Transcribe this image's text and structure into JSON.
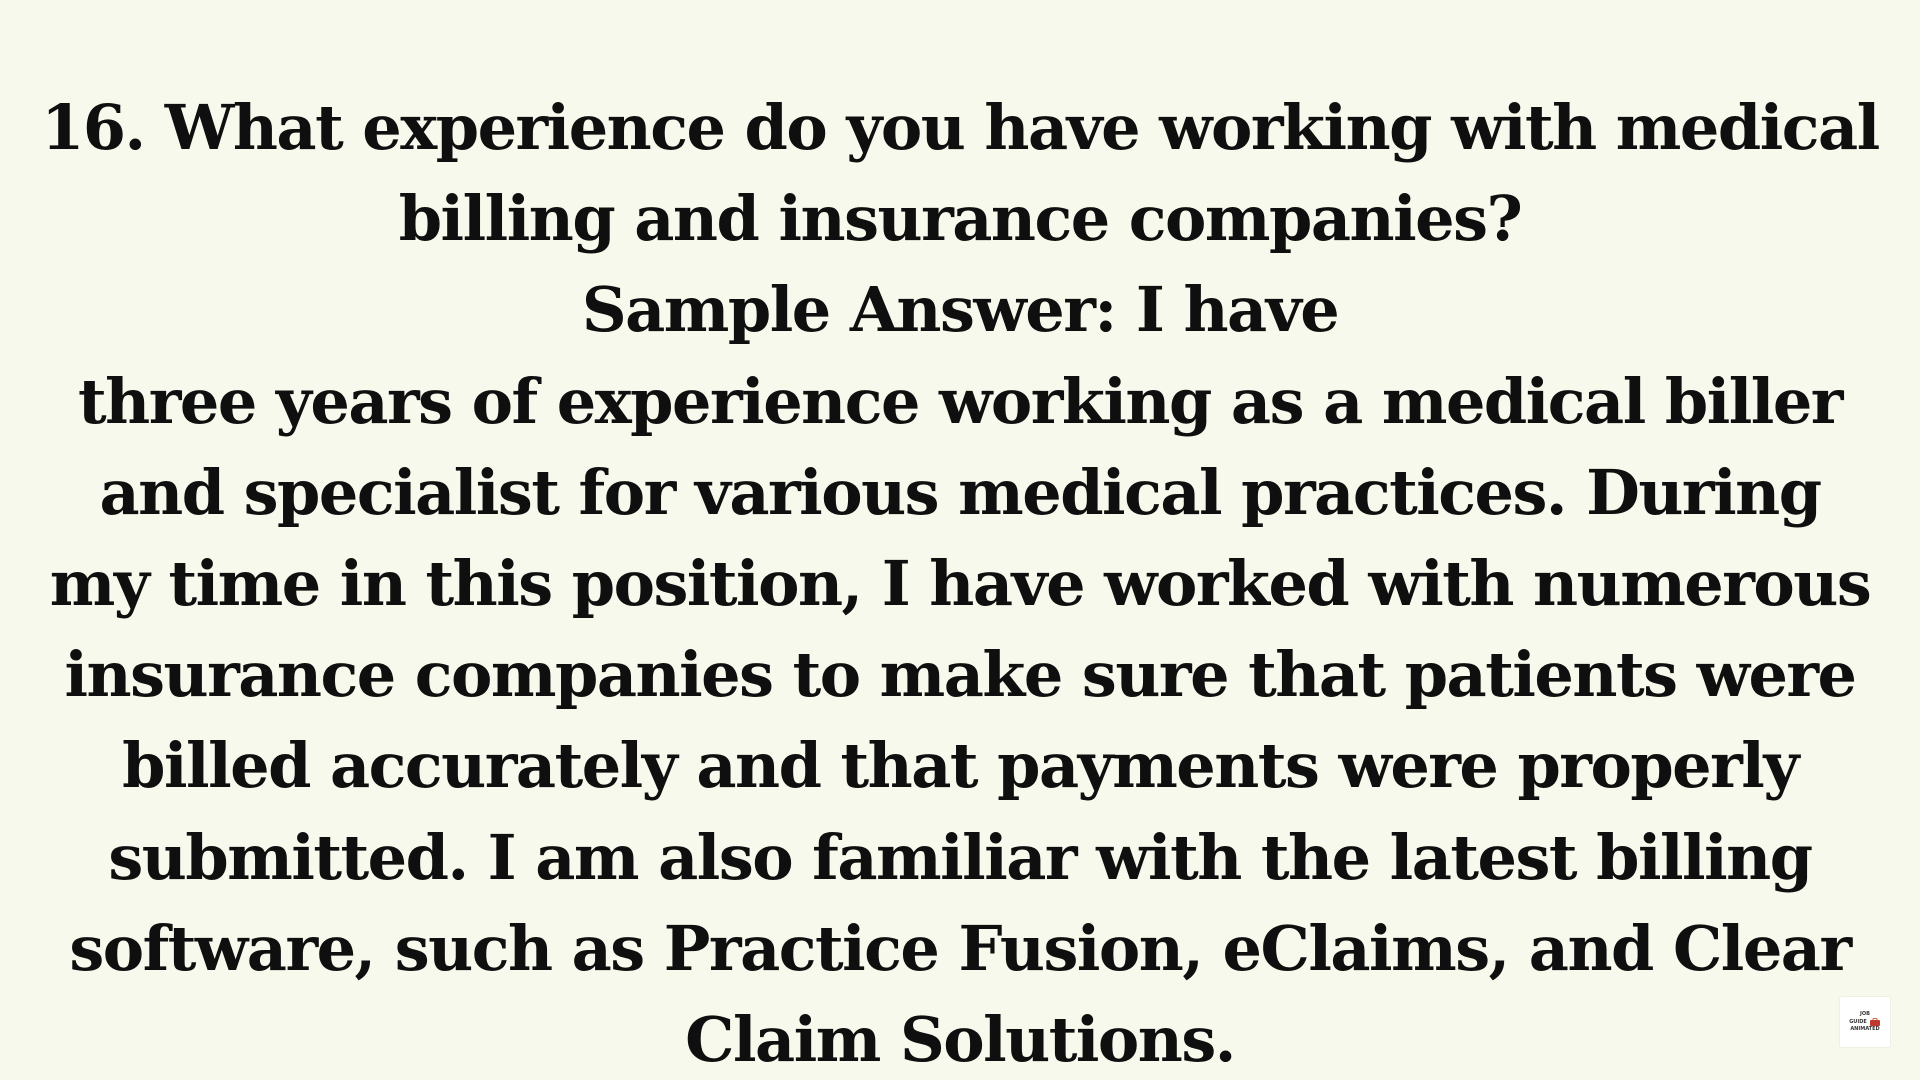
{
  "question": {
    "lines": [
      "16. What experience do you have working with medical",
      "billing and insurance companies?"
    ]
  },
  "answer": {
    "lines": [
      "Sample Answer: I have",
      "three years of experience working as a medical biller",
      "and specialist for various medical practices. During",
      "my time in this position, I have worked with numerous",
      "insurance companies to make sure that patients were",
      "billed accurately and that payments were properly",
      "submitted. I am also familiar with the latest billing",
      "software, such as Practice Fusion, eClaims, and Clear",
      "Claim Solutions."
    ]
  },
  "watermark": {
    "line1": "JOB",
    "line2": "GUIDE",
    "line3": "ANIMATED",
    "accent_color": "#c0392b"
  }
}
